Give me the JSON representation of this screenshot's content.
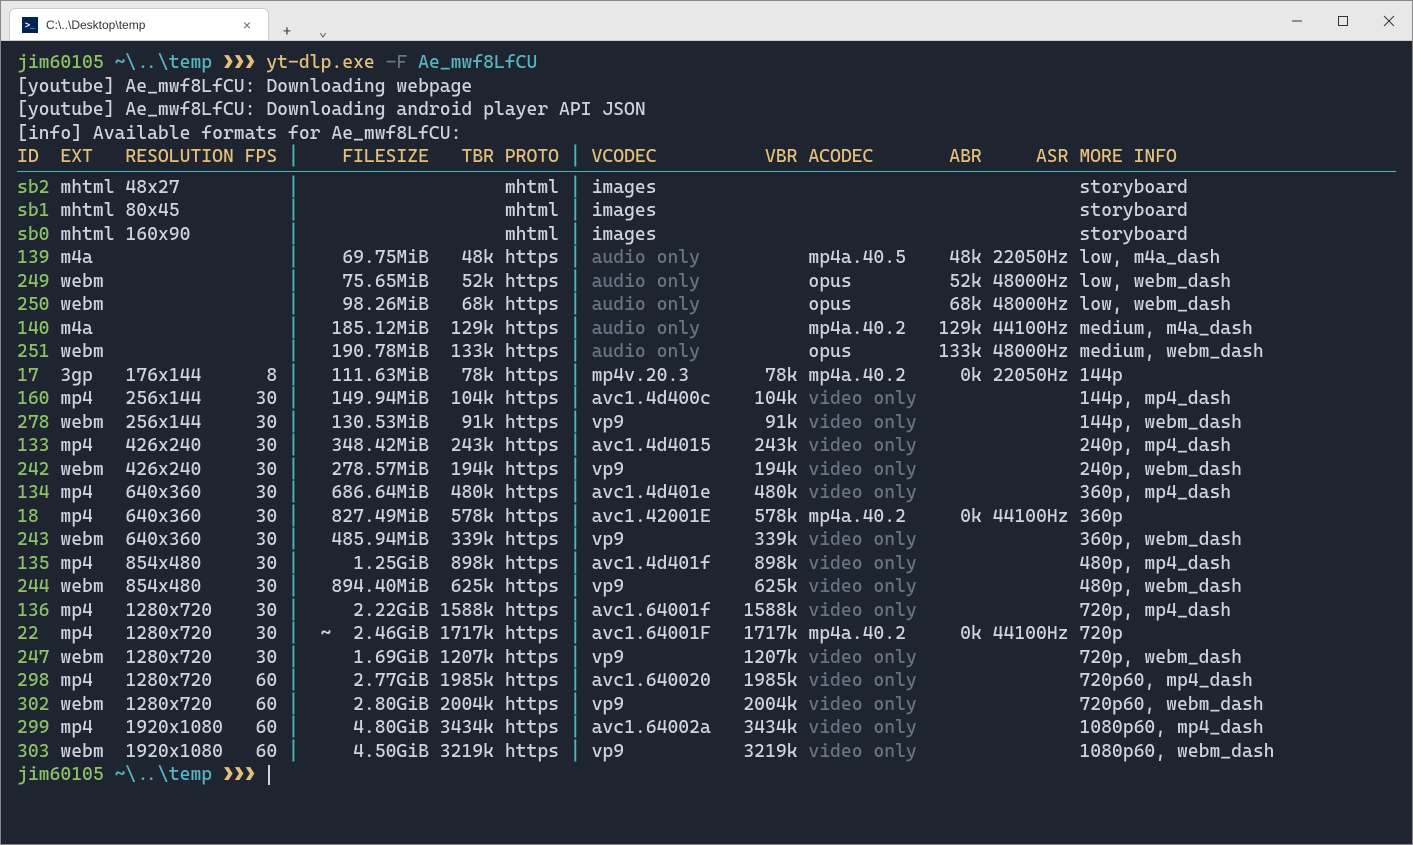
{
  "tab": {
    "title": "C:\\..\\Desktop\\temp",
    "icon_text": ">_"
  },
  "prompt": {
    "user": "jim60105",
    "path": "~\\..\\temp",
    "arrows": "❯❯❯"
  },
  "command": {
    "program": "yt-dlp.exe",
    "flag": "-F",
    "arg": "Ae_mwf8LfCU"
  },
  "lines": {
    "l1": "[youtube] Ae_mwf8LfCU: Downloading webpage",
    "l2": "[youtube] Ae_mwf8LfCU: Downloading android player API JSON",
    "l3": "[info] Available formats for Ae_mwf8LfCU:"
  },
  "headers": {
    "id": "ID",
    "ext": "EXT",
    "resolution": "RESOLUTION",
    "fps": "FPS",
    "filesize": "FILESIZE",
    "tbr": "TBR",
    "proto": "PROTO",
    "vcodec": "VCODEC",
    "vbr": "VBR",
    "acodec": "ACODEC",
    "abr": "ABR",
    "asr": "ASR",
    "more": "MORE INFO"
  },
  "rows": [
    {
      "id": "sb2",
      "ext": "mhtml",
      "res": "48x27",
      "fps": "",
      "fs": "",
      "tbr": "",
      "proto": "mhtml",
      "vc": "images",
      "vbr": "",
      "ac": "",
      "abr": "",
      "asr": "",
      "more": "storyboard",
      "vc_dim": false,
      "ac_dim": false
    },
    {
      "id": "sb1",
      "ext": "mhtml",
      "res": "80x45",
      "fps": "",
      "fs": "",
      "tbr": "",
      "proto": "mhtml",
      "vc": "images",
      "vbr": "",
      "ac": "",
      "abr": "",
      "asr": "",
      "more": "storyboard",
      "vc_dim": false,
      "ac_dim": false
    },
    {
      "id": "sb0",
      "ext": "mhtml",
      "res": "160x90",
      "fps": "",
      "fs": "",
      "tbr": "",
      "proto": "mhtml",
      "vc": "images",
      "vbr": "",
      "ac": "",
      "abr": "",
      "asr": "",
      "more": "storyboard",
      "vc_dim": false,
      "ac_dim": false
    },
    {
      "id": "139",
      "ext": "m4a",
      "res": "",
      "fps": "",
      "fs": "69.75MiB",
      "tbr": "48k",
      "proto": "https",
      "vc": "audio only",
      "vbr": "",
      "ac": "mp4a.40.5",
      "abr": "48k",
      "asr": "22050Hz",
      "more": "low, m4a_dash",
      "vc_dim": true,
      "ac_dim": false
    },
    {
      "id": "249",
      "ext": "webm",
      "res": "",
      "fps": "",
      "fs": "75.65MiB",
      "tbr": "52k",
      "proto": "https",
      "vc": "audio only",
      "vbr": "",
      "ac": "opus",
      "abr": "52k",
      "asr": "48000Hz",
      "more": "low, webm_dash",
      "vc_dim": true,
      "ac_dim": false
    },
    {
      "id": "250",
      "ext": "webm",
      "res": "",
      "fps": "",
      "fs": "98.26MiB",
      "tbr": "68k",
      "proto": "https",
      "vc": "audio only",
      "vbr": "",
      "ac": "opus",
      "abr": "68k",
      "asr": "48000Hz",
      "more": "low, webm_dash",
      "vc_dim": true,
      "ac_dim": false
    },
    {
      "id": "140",
      "ext": "m4a",
      "res": "",
      "fps": "",
      "fs": "185.12MiB",
      "tbr": "129k",
      "proto": "https",
      "vc": "audio only",
      "vbr": "",
      "ac": "mp4a.40.2",
      "abr": "129k",
      "asr": "44100Hz",
      "more": "medium, m4a_dash",
      "vc_dim": true,
      "ac_dim": false
    },
    {
      "id": "251",
      "ext": "webm",
      "res": "",
      "fps": "",
      "fs": "190.78MiB",
      "tbr": "133k",
      "proto": "https",
      "vc": "audio only",
      "vbr": "",
      "ac": "opus",
      "abr": "133k",
      "asr": "48000Hz",
      "more": "medium, webm_dash",
      "vc_dim": true,
      "ac_dim": false
    },
    {
      "id": "17",
      "ext": "3gp",
      "res": "176x144",
      "fps": "8",
      "fs": "111.63MiB",
      "tbr": "78k",
      "proto": "https",
      "vc": "mp4v.20.3",
      "vbr": "78k",
      "ac": "mp4a.40.2",
      "abr": "0k",
      "asr": "22050Hz",
      "more": "144p",
      "vc_dim": false,
      "ac_dim": false
    },
    {
      "id": "160",
      "ext": "mp4",
      "res": "256x144",
      "fps": "30",
      "fs": "149.94MiB",
      "tbr": "104k",
      "proto": "https",
      "vc": "avc1.4d400c",
      "vbr": "104k",
      "ac": "video only",
      "abr": "",
      "asr": "",
      "more": "144p, mp4_dash",
      "vc_dim": false,
      "ac_dim": true
    },
    {
      "id": "278",
      "ext": "webm",
      "res": "256x144",
      "fps": "30",
      "fs": "130.53MiB",
      "tbr": "91k",
      "proto": "https",
      "vc": "vp9",
      "vbr": "91k",
      "ac": "video only",
      "abr": "",
      "asr": "",
      "more": "144p, webm_dash",
      "vc_dim": false,
      "ac_dim": true
    },
    {
      "id": "133",
      "ext": "mp4",
      "res": "426x240",
      "fps": "30",
      "fs": "348.42MiB",
      "tbr": "243k",
      "proto": "https",
      "vc": "avc1.4d4015",
      "vbr": "243k",
      "ac": "video only",
      "abr": "",
      "asr": "",
      "more": "240p, mp4_dash",
      "vc_dim": false,
      "ac_dim": true
    },
    {
      "id": "242",
      "ext": "webm",
      "res": "426x240",
      "fps": "30",
      "fs": "278.57MiB",
      "tbr": "194k",
      "proto": "https",
      "vc": "vp9",
      "vbr": "194k",
      "ac": "video only",
      "abr": "",
      "asr": "",
      "more": "240p, webm_dash",
      "vc_dim": false,
      "ac_dim": true
    },
    {
      "id": "134",
      "ext": "mp4",
      "res": "640x360",
      "fps": "30",
      "fs": "686.64MiB",
      "tbr": "480k",
      "proto": "https",
      "vc": "avc1.4d401e",
      "vbr": "480k",
      "ac": "video only",
      "abr": "",
      "asr": "",
      "more": "360p, mp4_dash",
      "vc_dim": false,
      "ac_dim": true
    },
    {
      "id": "18",
      "ext": "mp4",
      "res": "640x360",
      "fps": "30",
      "fs": "827.49MiB",
      "tbr": "578k",
      "proto": "https",
      "vc": "avc1.42001E",
      "vbr": "578k",
      "ac": "mp4a.40.2",
      "abr": "0k",
      "asr": "44100Hz",
      "more": "360p",
      "vc_dim": false,
      "ac_dim": false
    },
    {
      "id": "243",
      "ext": "webm",
      "res": "640x360",
      "fps": "30",
      "fs": "485.94MiB",
      "tbr": "339k",
      "proto": "https",
      "vc": "vp9",
      "vbr": "339k",
      "ac": "video only",
      "abr": "",
      "asr": "",
      "more": "360p, webm_dash",
      "vc_dim": false,
      "ac_dim": true
    },
    {
      "id": "135",
      "ext": "mp4",
      "res": "854x480",
      "fps": "30",
      "fs": "1.25GiB",
      "tbr": "898k",
      "proto": "https",
      "vc": "avc1.4d401f",
      "vbr": "898k",
      "ac": "video only",
      "abr": "",
      "asr": "",
      "more": "480p, mp4_dash",
      "vc_dim": false,
      "ac_dim": true
    },
    {
      "id": "244",
      "ext": "webm",
      "res": "854x480",
      "fps": "30",
      "fs": "894.40MiB",
      "tbr": "625k",
      "proto": "https",
      "vc": "vp9",
      "vbr": "625k",
      "ac": "video only",
      "abr": "",
      "asr": "",
      "more": "480p, webm_dash",
      "vc_dim": false,
      "ac_dim": true
    },
    {
      "id": "136",
      "ext": "mp4",
      "res": "1280x720",
      "fps": "30",
      "fs": "2.22GiB",
      "tbr": "1588k",
      "proto": "https",
      "vc": "avc1.64001f",
      "vbr": "1588k",
      "ac": "video only",
      "abr": "",
      "asr": "",
      "more": "720p, mp4_dash",
      "vc_dim": false,
      "ac_dim": true
    },
    {
      "id": "22",
      "ext": "mp4",
      "res": "1280x720",
      "fps": "30",
      "fs": "~  2.46GiB",
      "tbr": "1717k",
      "proto": "https",
      "vc": "avc1.64001F",
      "vbr": "1717k",
      "ac": "mp4a.40.2",
      "abr": "0k",
      "asr": "44100Hz",
      "more": "720p",
      "vc_dim": false,
      "ac_dim": false
    },
    {
      "id": "247",
      "ext": "webm",
      "res": "1280x720",
      "fps": "30",
      "fs": "1.69GiB",
      "tbr": "1207k",
      "proto": "https",
      "vc": "vp9",
      "vbr": "1207k",
      "ac": "video only",
      "abr": "",
      "asr": "",
      "more": "720p, webm_dash",
      "vc_dim": false,
      "ac_dim": true
    },
    {
      "id": "298",
      "ext": "mp4",
      "res": "1280x720",
      "fps": "60",
      "fs": "2.77GiB",
      "tbr": "1985k",
      "proto": "https",
      "vc": "avc1.640020",
      "vbr": "1985k",
      "ac": "video only",
      "abr": "",
      "asr": "",
      "more": "720p60, mp4_dash",
      "vc_dim": false,
      "ac_dim": true
    },
    {
      "id": "302",
      "ext": "webm",
      "res": "1280x720",
      "fps": "60",
      "fs": "2.80GiB",
      "tbr": "2004k",
      "proto": "https",
      "vc": "vp9",
      "vbr": "2004k",
      "ac": "video only",
      "abr": "",
      "asr": "",
      "more": "720p60, webm_dash",
      "vc_dim": false,
      "ac_dim": true
    },
    {
      "id": "299",
      "ext": "mp4",
      "res": "1920x1080",
      "fps": "60",
      "fs": "4.80GiB",
      "tbr": "3434k",
      "proto": "https",
      "vc": "avc1.64002a",
      "vbr": "3434k",
      "ac": "video only",
      "abr": "",
      "asr": "",
      "more": "1080p60, mp4_dash",
      "vc_dim": false,
      "ac_dim": true
    },
    {
      "id": "303",
      "ext": "webm",
      "res": "1920x1080",
      "fps": "60",
      "fs": "4.50GiB",
      "tbr": "3219k",
      "proto": "https",
      "vc": "vp9",
      "vbr": "3219k",
      "ac": "video only",
      "abr": "",
      "asr": "",
      "more": "1080p60, webm_dash",
      "vc_dim": false,
      "ac_dim": true
    }
  ]
}
